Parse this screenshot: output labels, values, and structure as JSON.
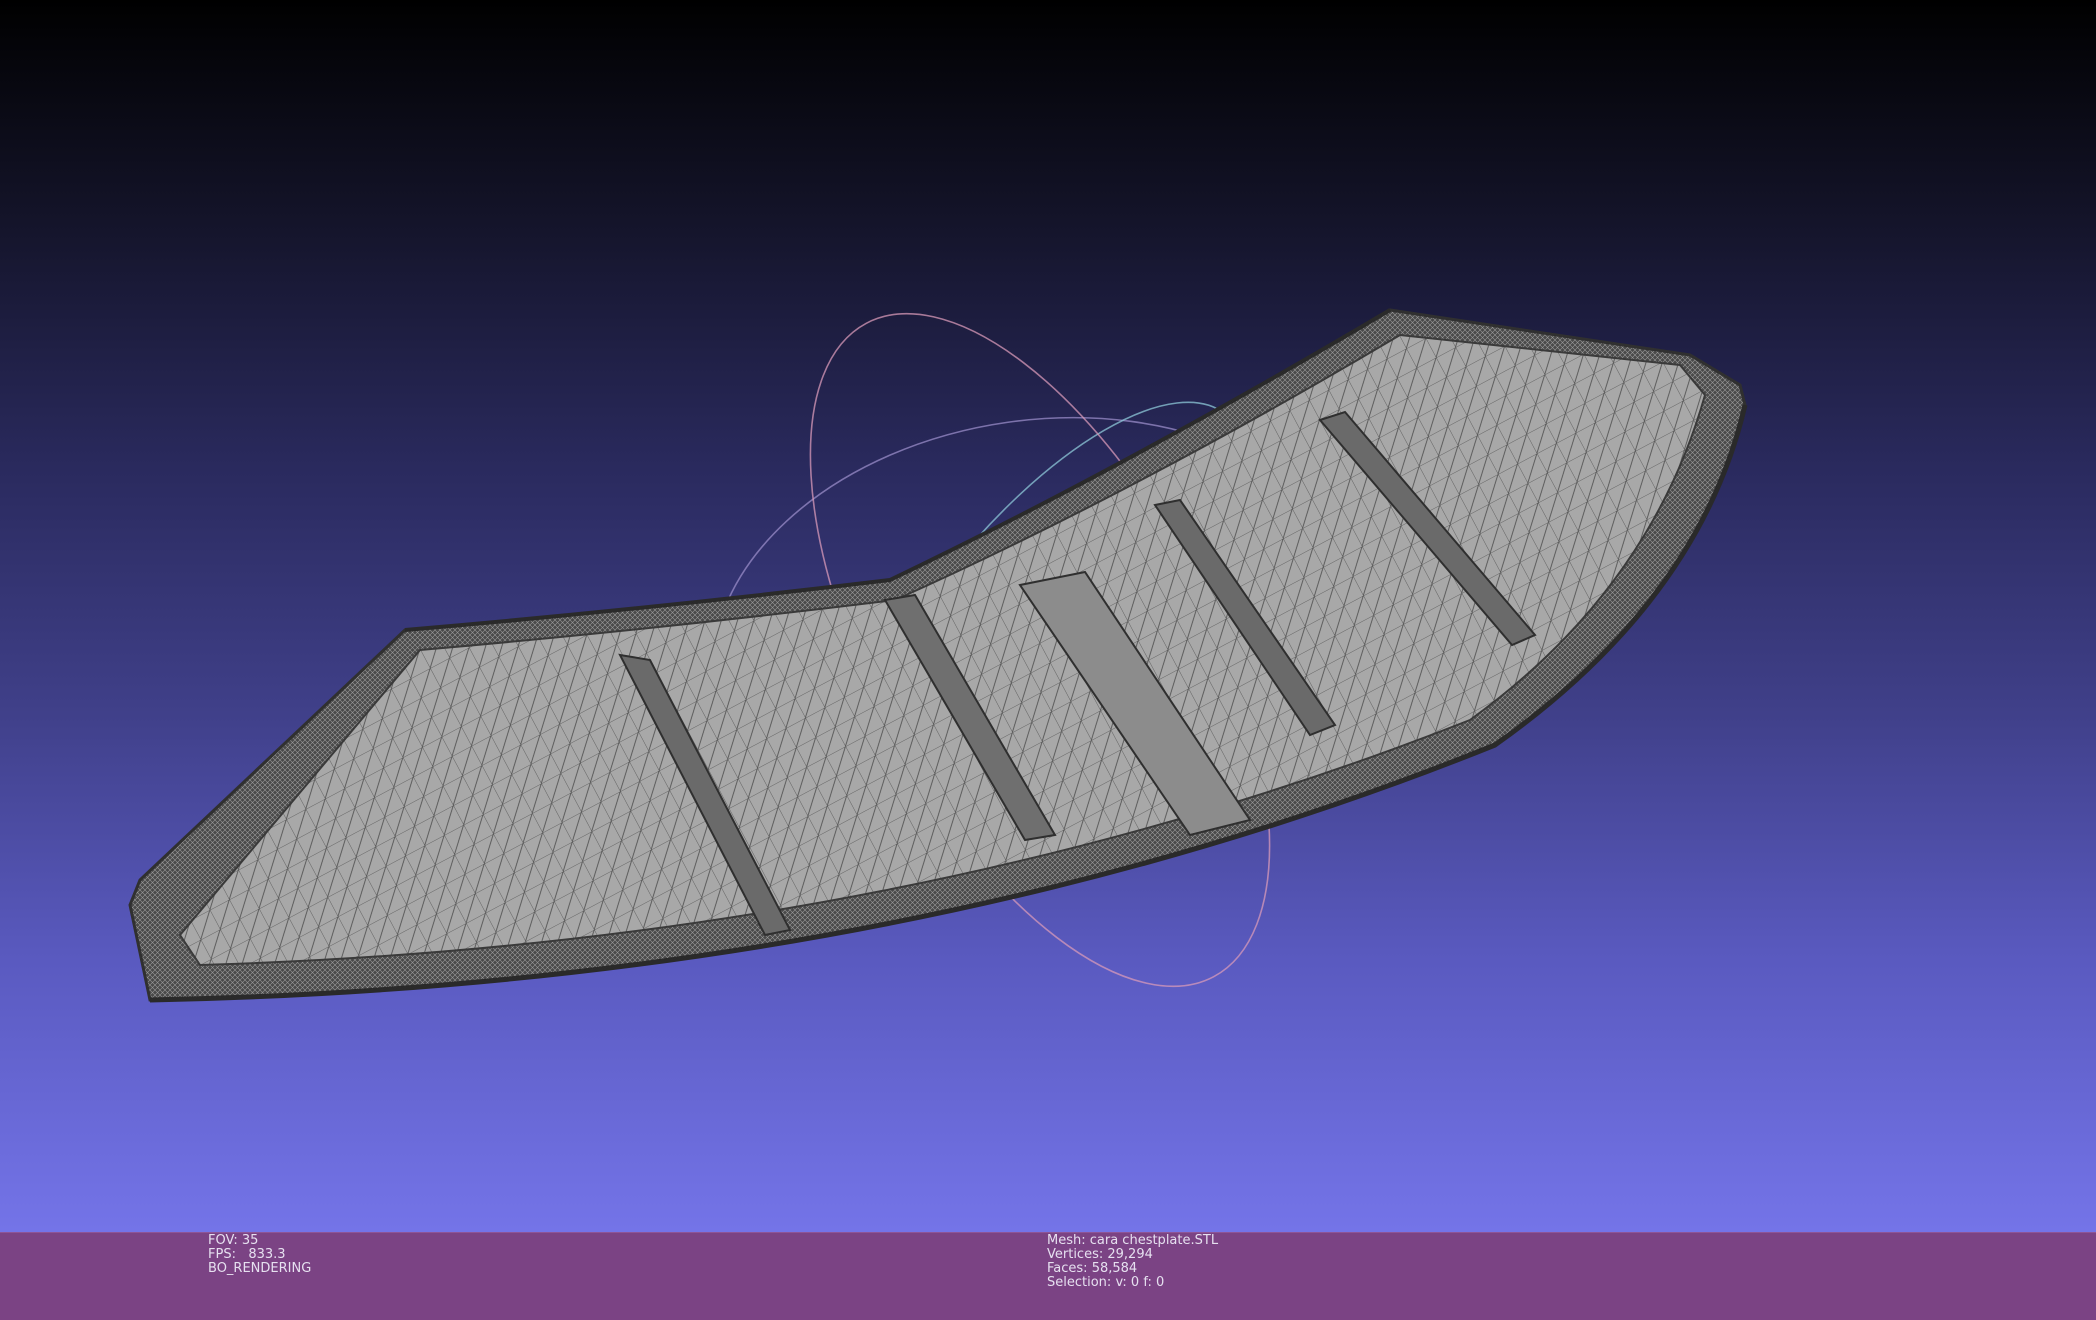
{
  "viewport": {
    "background_top": "#000000",
    "background_bottom": "#7474e8",
    "mesh_fill": "#a6a6a6",
    "mesh_edge": "#3c3c3c",
    "trackball_colors": [
      "#d89ab8",
      "#8ec8d8",
      "#9a8cc8"
    ]
  },
  "status_left": {
    "fov_label": "FOV:",
    "fov_value": "35",
    "fps_label": "FPS:",
    "fps_value": "833.3",
    "render_mode": "BO_RENDERING"
  },
  "status_right": {
    "mesh_label": "Mesh:",
    "mesh_name": "cara chestplate.STL",
    "vertices_label": "Vertices:",
    "vertices_value": "29,294",
    "faces_label": "Faces:",
    "faces_value": "58,584",
    "selection_label": "Selection:",
    "selection_value": "v: 0 f: 0"
  }
}
